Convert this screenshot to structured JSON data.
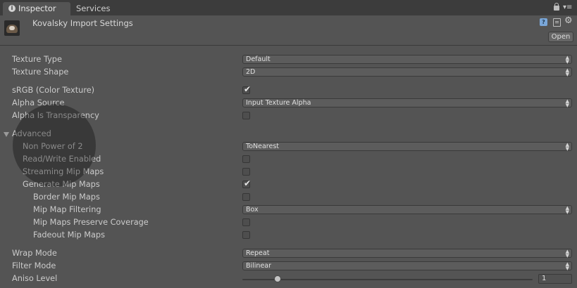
{
  "tabs": [
    {
      "label": "Inspector",
      "icon": "info-icon",
      "active": true
    },
    {
      "label": "Services",
      "active": false
    }
  ],
  "header": {
    "title": "Kovalsky Import Settings",
    "open_label": "Open",
    "icons": [
      "help-icon",
      "preset-icon",
      "gear-icon"
    ]
  },
  "fields": {
    "texture_type": {
      "label": "Texture Type",
      "value": "Default"
    },
    "texture_shape": {
      "label": "Texture Shape",
      "value": "2D"
    },
    "srgb": {
      "label": "sRGB (Color Texture)",
      "checked": true
    },
    "alpha_source": {
      "label": "Alpha Source",
      "value": "Input Texture Alpha"
    },
    "alpha_is_transparency": {
      "label": "Alpha Is Transparency",
      "checked": false
    },
    "advanced": {
      "label": "Advanced",
      "expanded": true
    },
    "non_power_of_2": {
      "label": "Non Power of 2",
      "value": "ToNearest"
    },
    "read_write": {
      "label": "Read/Write Enabled",
      "checked": false
    },
    "streaming_mip_maps": {
      "label": "Streaming Mip Maps",
      "checked": false
    },
    "generate_mip_maps": {
      "label": "Generate Mip Maps",
      "checked": true
    },
    "border_mip_maps": {
      "label": "Border Mip Maps",
      "checked": false
    },
    "mip_map_filtering": {
      "label": "Mip Map Filtering",
      "value": "Box"
    },
    "preserve_coverage": {
      "label": "Mip Maps Preserve Coverage",
      "checked": false
    },
    "fadeout_mip_maps": {
      "label": "Fadeout Mip Maps",
      "checked": false
    },
    "wrap_mode": {
      "label": "Wrap Mode",
      "value": "Repeat"
    },
    "filter_mode": {
      "label": "Filter Mode",
      "value": "Bilinear"
    },
    "aniso_level": {
      "label": "Aniso Level",
      "value": "1",
      "min": 0,
      "max": 16
    }
  },
  "glyphs": {
    "check": "✔",
    "arrows": "▲▼",
    "gear": "⚙",
    "menu": "▾≡",
    "info": "i",
    "help": "?"
  }
}
